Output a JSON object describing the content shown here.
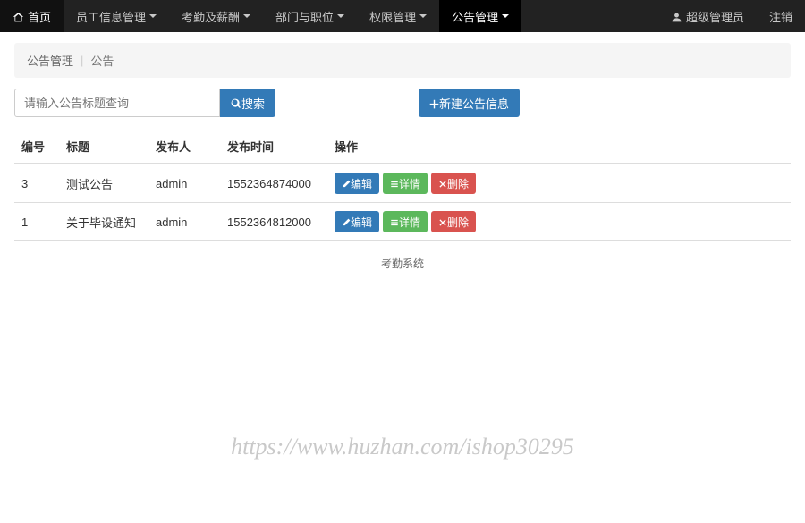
{
  "nav": {
    "home": "首页",
    "items": [
      "员工信息管理",
      "考勤及薪酬",
      "部门与职位",
      "权限管理",
      "公告管理"
    ],
    "active_index": 4,
    "user_label": "超级管理员",
    "logout": "注销"
  },
  "breadcrumb": {
    "parent": "公告管理",
    "current": "公告"
  },
  "search": {
    "placeholder": "请输入公告标题查询",
    "button": "搜索"
  },
  "create_button": "新建公告信息",
  "table": {
    "headers": [
      "编号",
      "标题",
      "发布人",
      "发布时间",
      "操作"
    ],
    "rows": [
      {
        "id": "3",
        "title": "测试公告",
        "author": "admin",
        "time": "1552364874000"
      },
      {
        "id": "1",
        "title": "关于毕设通知",
        "author": "admin",
        "time": "1552364812000"
      }
    ],
    "actions": {
      "edit": "编辑",
      "detail": "详情",
      "delete": "删除"
    }
  },
  "footer": "考勤系统",
  "watermark": "https://www.huzhan.com/ishop30295"
}
